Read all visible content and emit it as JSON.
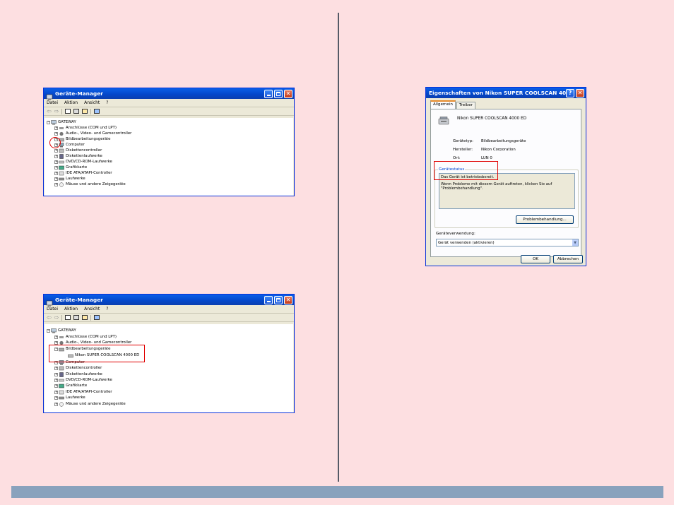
{
  "dm_window": {
    "title": "Geräte-Manager",
    "menu": [
      "Datei",
      "Aktion",
      "Ansicht",
      "?"
    ],
    "nav_back": "⇦",
    "nav_forward": "⇨",
    "tree_root": "GATEWAY",
    "expander_collapsed": "+",
    "expander_expanded": "−",
    "tree_items": [
      "Anschlüsse (COM und LPT)",
      "Audio-, Video- und Gamecontroller",
      "Bildbearbeitungsgeräte",
      "Computer",
      "Diskettencontroller",
      "Diskettenlaufwerke",
      "DVD/CD-ROM-Laufwerke",
      "Grafikkarte",
      "IDE ATA/ATAPI-Controller",
      "Laufwerke",
      "Mäuse und andere Zeigegeräte"
    ],
    "tree_items_second": [
      "Anschlüsse (COM und LPT)",
      "Audio-, Video- und Gamecontroller",
      "Bildbearbeitungsgeräte",
      "Nikon SUPER COOLSCAN 4000 ED",
      "Computer",
      "Diskettencontroller",
      "Diskettenlaufwerke",
      "DVD/CD-ROM-Laufwerke",
      "Grafikkarte",
      "IDE ATA/ATAPI-Controller",
      "Laufwerke",
      "Mäuse und andere Zeigegeräte"
    ]
  },
  "props_dialog": {
    "title": "Eigenschaften von Nikon SUPER COOLSCAN 4000 ED",
    "help_glyph": "?",
    "close_glyph": "✕",
    "tabs": [
      "Allgemein",
      "Treiber"
    ],
    "device_name": "Nikon SUPER COOLSCAN 4000 ED",
    "device_type_label": "Gerätetyp:",
    "device_type_value": "Bildbearbeitungsgeräte",
    "manufacturer_label": "Hersteller:",
    "manufacturer_value": "Nikon Corporation",
    "location_label": "Ort:",
    "location_value": "LUN 0",
    "status_group_title": "Gerätestatus",
    "status_line1": "Das Gerät ist betriebsbereit.",
    "status_line2": "Wenn Probleme mit diesem Gerät auftreten, klicken Sie auf \"Problembehandlung\".",
    "troubleshoot_button": "Problembehandlung...",
    "usage_label": "Geräteverwendung:",
    "usage_value": "Gerät verwenden (aktivieren)",
    "select_arrow": "▼",
    "ok_button": "OK",
    "cancel_button": "Abbrechen"
  },
  "colors": {
    "background": "#fddfe1",
    "footer_bar": "#89a2bd",
    "divider": "#555a66",
    "highlight_red": "#e00000",
    "xp_titlebar_blue": "#0447c9"
  },
  "icons": {
    "device_manager": "device-manager-icon",
    "computer": "computer-icon",
    "scanner": "scanner-icon"
  }
}
